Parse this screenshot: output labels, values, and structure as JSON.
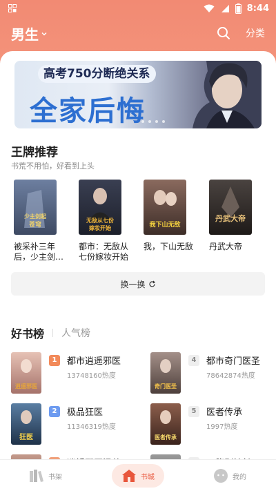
{
  "status_bar": {
    "time": "8:44"
  },
  "top_bar": {
    "gender_label": "男生",
    "category_label": "分类"
  },
  "banner": {
    "pill_text": "高考750分断绝关系",
    "big_text": "全家后悔"
  },
  "ace_section": {
    "title": "王牌推荐",
    "subtitle": "书荒不用怕，好看到上头"
  },
  "recommendations": [
    {
      "title": "被采补三年后，少主剑…",
      "cover_text": "被采补三年后 少主剑起 苍穹",
      "cover_color": "#5a6b86"
    },
    {
      "title": "都市：无敌从七份嫁妆开始",
      "cover_text": "无敌从七份 嫁妆开始",
      "cover_color": "#2b2f3d"
    },
    {
      "title": "我，下山无敌",
      "cover_text": "我下山无敌",
      "cover_color": "#7a5a4e"
    },
    {
      "title": "丹武大帝",
      "cover_text": "丹武大帝",
      "cover_color": "#3a3430"
    }
  ],
  "swap_button": {
    "label": "换一换"
  },
  "ranking_tabs": {
    "active": "好书榜",
    "inactive": "人气榜"
  },
  "rankings": [
    {
      "rank": "1",
      "title": "都市逍遥邪医",
      "heat": "13748160热度",
      "badge_color": "#f28a5a",
      "cover_text": "逍遥邪医",
      "cover_color": "#c98f8a"
    },
    {
      "rank": "4",
      "title": "都市奇门医圣",
      "heat": "78642874热度",
      "badge_color": "#d9d9d9",
      "cover_text": "奇门医圣",
      "cover_color": "#8d7b76"
    },
    {
      "rank": "2",
      "title": "极品狂医",
      "heat": "11346319热度",
      "badge_color": "#6d9bf0",
      "cover_text": "狂医",
      "cover_color": "#3e5b7a"
    },
    {
      "rank": "5",
      "title": "医者传承",
      "heat": "1997热度",
      "badge_color": "#d9d9d9",
      "cover_text": "医者传承",
      "cover_color": "#6b4a3e"
    },
    {
      "rank": "",
      "title": "逍婚邪医温莱",
      "heat": "",
      "badge_color": "#f0a07a",
      "cover_text": "",
      "cover_color": "#b58b7d"
    },
    {
      "rank": "",
      "title": "天秘剥神长",
      "heat": "",
      "badge_color": "#d9d9d9",
      "cover_text": "",
      "cover_color": "#8a8a8a"
    }
  ],
  "bottom_nav": {
    "bookshelf": "书架",
    "bookstore": "书城",
    "mine": "我的"
  },
  "colors": {
    "header": "#f28a73",
    "accent": "#e8563c",
    "banner_text": "#2d6fd1"
  }
}
